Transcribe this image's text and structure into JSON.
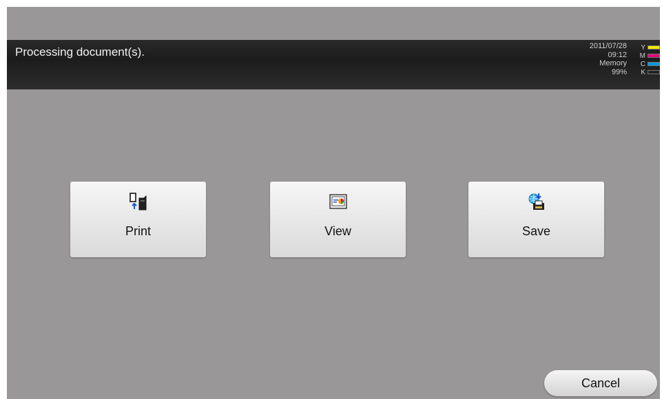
{
  "status": {
    "message": "Processing document(s).",
    "date": "2011/07/28",
    "time": "09:12",
    "memory_label": "Memory",
    "memory_value": "99%",
    "toner": [
      {
        "letter": "Y",
        "color": "#f2e600"
      },
      {
        "letter": "M",
        "color": "#e2007a"
      },
      {
        "letter": "C",
        "color": "#0099dd"
      },
      {
        "letter": "K",
        "color": "#222222"
      }
    ]
  },
  "actions": {
    "print": {
      "label": "Print",
      "icon": "print-icon"
    },
    "view": {
      "label": "View",
      "icon": "view-icon"
    },
    "save": {
      "label": "Save",
      "icon": "save-icon"
    }
  },
  "cancel": {
    "label": "Cancel"
  }
}
